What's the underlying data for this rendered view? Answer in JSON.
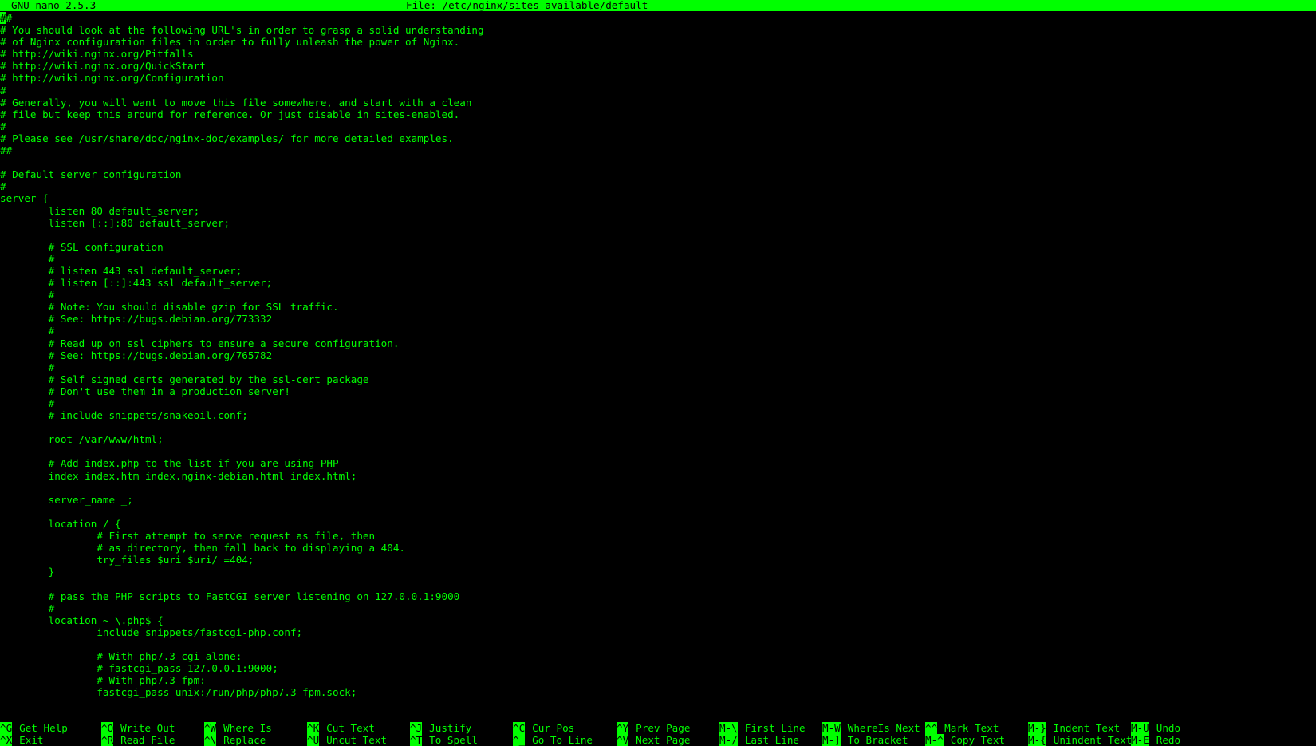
{
  "titlebar": {
    "version": "GNU nano 2.5.3",
    "file_label": "File: /etc/nginx/sites-available/default"
  },
  "editor": {
    "cursor_char": "#",
    "first_line_rest": "#",
    "lines": [
      "# You should look at the following URL's in order to grasp a solid understanding",
      "# of Nginx configuration files in order to fully unleash the power of Nginx.",
      "# http://wiki.nginx.org/Pitfalls",
      "# http://wiki.nginx.org/QuickStart",
      "# http://wiki.nginx.org/Configuration",
      "#",
      "# Generally, you will want to move this file somewhere, and start with a clean",
      "# file but keep this around for reference. Or just disable in sites-enabled.",
      "#",
      "# Please see /usr/share/doc/nginx-doc/examples/ for more detailed examples.",
      "##",
      "",
      "# Default server configuration",
      "#",
      "server {",
      "        listen 80 default_server;",
      "        listen [::]:80 default_server;",
      "",
      "        # SSL configuration",
      "        #",
      "        # listen 443 ssl default_server;",
      "        # listen [::]:443 ssl default_server;",
      "        #",
      "        # Note: You should disable gzip for SSL traffic.",
      "        # See: https://bugs.debian.org/773332",
      "        #",
      "        # Read up on ssl_ciphers to ensure a secure configuration.",
      "        # See: https://bugs.debian.org/765782",
      "        #",
      "        # Self signed certs generated by the ssl-cert package",
      "        # Don't use them in a production server!",
      "        #",
      "        # include snippets/snakeoil.conf;",
      "",
      "        root /var/www/html;",
      "",
      "        # Add index.php to the list if you are using PHP",
      "        index index.htm index.nginx-debian.html index.html;",
      "",
      "        server_name _;",
      "",
      "        location / {",
      "                # First attempt to serve request as file, then",
      "                # as directory, then fall back to displaying a 404.",
      "                try_files $uri $uri/ =404;",
      "        }",
      "",
      "        # pass the PHP scripts to FastCGI server listening on 127.0.0.1:9000",
      "        #",
      "        location ~ \\.php$ {",
      "                include snippets/fastcgi-php.conf;",
      "",
      "                # With php7.3-cgi alone:",
      "                # fastcgi_pass 127.0.0.1:9000;",
      "                # With php7.3-fpm:",
      "                fastcgi_pass unix:/run/php/php7.3-fpm.sock;"
    ]
  },
  "shortcuts": [
    {
      "key": "^G",
      "label": "Get Help"
    },
    {
      "key": "^X",
      "label": "Exit"
    },
    {
      "key": "^O",
      "label": "Write Out"
    },
    {
      "key": "^R",
      "label": "Read File"
    },
    {
      "key": "^W",
      "label": "Where Is"
    },
    {
      "key": "^\\",
      "label": "Replace"
    },
    {
      "key": "^K",
      "label": "Cut Text"
    },
    {
      "key": "^U",
      "label": "Uncut Text"
    },
    {
      "key": "^J",
      "label": "Justify"
    },
    {
      "key": "^T",
      "label": "To Spell"
    },
    {
      "key": "^C",
      "label": "Cur Pos"
    },
    {
      "key": "^_",
      "label": "Go To Line"
    },
    {
      "key": "^Y",
      "label": "Prev Page"
    },
    {
      "key": "^V",
      "label": "Next Page"
    },
    {
      "key": "M-\\",
      "label": "First Line"
    },
    {
      "key": "M-/",
      "label": "Last Line"
    },
    {
      "key": "M-W",
      "label": "WhereIs Next"
    },
    {
      "key": "M-]",
      "label": "To Bracket"
    },
    {
      "key": "^^",
      "label": "Mark Text"
    },
    {
      "key": "M-^",
      "label": "Copy Text"
    },
    {
      "key": "M-}",
      "label": "Indent Text"
    },
    {
      "key": "M-{",
      "label": "Unindent Text"
    },
    {
      "key": "M-U",
      "label": "Undo"
    },
    {
      "key": "M-E",
      "label": "Redo"
    }
  ],
  "colors": {
    "foreground": "#00ff00",
    "background": "#000000"
  }
}
